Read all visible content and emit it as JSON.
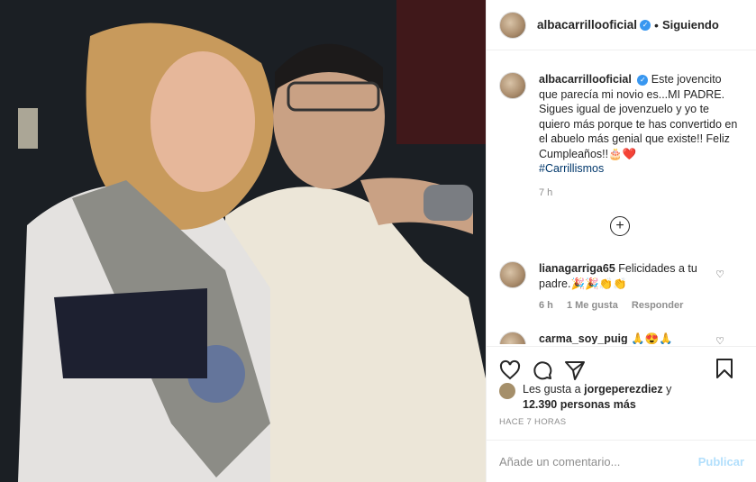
{
  "post": {
    "username": "albacarrillooficial",
    "follow_state": "Siguiendo",
    "dot": "•",
    "verified_mark": "✓"
  },
  "caption": {
    "username": "albacarrillooficial",
    "text": "Este jovencito que parecía mi novio es...MI PADRE. Sigues igual de jovenzuelo y yo te quiero más porque te has convertido en el abuelo más genial que existe!! Feliz Cumpleaños!!🎂❤️",
    "hashtag": "#Carrillismos",
    "time": "7 h"
  },
  "comments": [
    {
      "username": "lianagarriga65",
      "text": "Felicidades a tu padre.🎉🎉👏👏",
      "time": "6 h",
      "likes": "1 Me gusta",
      "reply": "Responder"
    },
    {
      "username": "carma_soy_puig",
      "text": "🙏😍🙏"
    }
  ],
  "likes": {
    "prefix": "Les gusta a ",
    "first_user": "jorgeperezdiez",
    "joiner": " y",
    "count": "12.390 personas más"
  },
  "timestamp": "HACE 7 HORAS",
  "add_comment": {
    "placeholder": "Añade un comentario...",
    "publish_label": "Publicar"
  },
  "icons": [
    "heart-icon",
    "comment-icon",
    "share-icon",
    "save-icon",
    "add-icon"
  ],
  "colors": {
    "verified": "#3897f0",
    "publish": "#b2dffc",
    "hashtag": "#00376b"
  }
}
